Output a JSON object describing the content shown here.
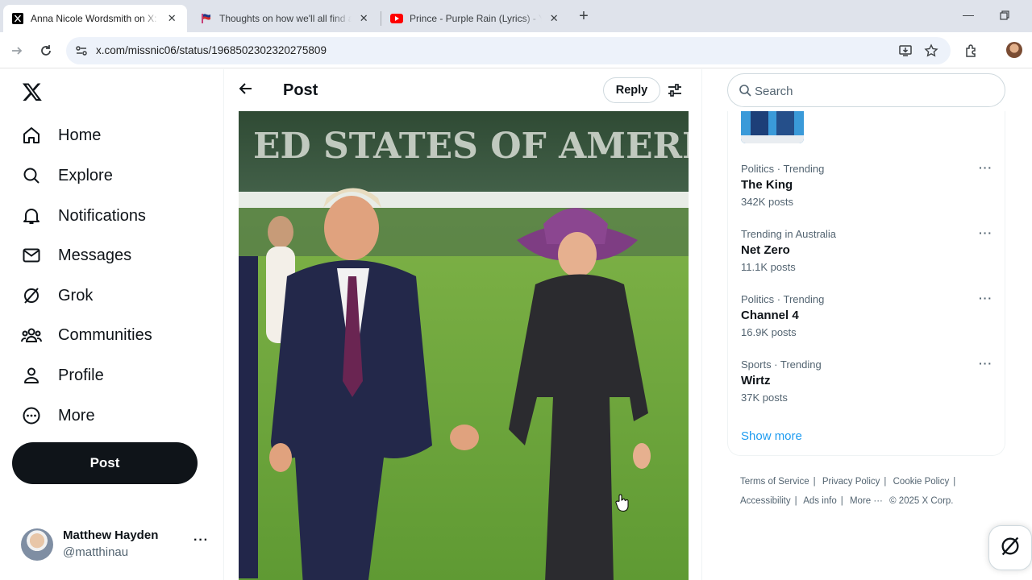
{
  "browser": {
    "tabs": [
      {
        "title": "Anna Nicole Wordsmith on X: \"I",
        "favicon": "x-logo-icon",
        "active": true
      },
      {
        "title": "Thoughts on how we'll all find a",
        "favicon": "flag-icon",
        "active": false
      },
      {
        "title": "Prince - Purple Rain (Lyrics) - Yo",
        "favicon": "youtube-icon",
        "active": false
      }
    ],
    "url": "x.com/missnic06/status/1968502302320275809"
  },
  "nav": {
    "items": [
      {
        "label": "Home",
        "icon": "home-icon"
      },
      {
        "label": "Explore",
        "icon": "search-icon"
      },
      {
        "label": "Notifications",
        "icon": "bell-icon"
      },
      {
        "label": "Messages",
        "icon": "envelope-icon"
      },
      {
        "label": "Grok",
        "icon": "grok-icon"
      },
      {
        "label": "Communities",
        "icon": "people-icon"
      },
      {
        "label": "Profile",
        "icon": "person-icon"
      },
      {
        "label": "More",
        "icon": "more-circle-icon"
      }
    ],
    "post_label": "Post",
    "account": {
      "name": "Matthew Hayden",
      "handle": "@matthinau"
    }
  },
  "main": {
    "title": "Post",
    "reply_label": "Reply",
    "photo_banner_text": "ED STATES OF AMERICA"
  },
  "sidebar": {
    "search_placeholder": "Search",
    "trends": [
      {
        "context": "Politics · Trending",
        "title": "The King",
        "posts": "342K posts"
      },
      {
        "context": "Trending in Australia",
        "title": "Net Zero",
        "posts": "11.1K posts"
      },
      {
        "context": "Politics · Trending",
        "title": "Channel 4",
        "posts": "16.9K posts"
      },
      {
        "context": "Sports · Trending",
        "title": "Wirtz",
        "posts": "37K posts"
      }
    ],
    "show_more": "Show more",
    "footer": {
      "terms": "Terms of Service",
      "privacy": "Privacy Policy",
      "cookie": "Cookie Policy",
      "accessibility": "Accessibility",
      "ads": "Ads info",
      "more": "More ···",
      "copyright": "© 2025 X Corp."
    }
  }
}
